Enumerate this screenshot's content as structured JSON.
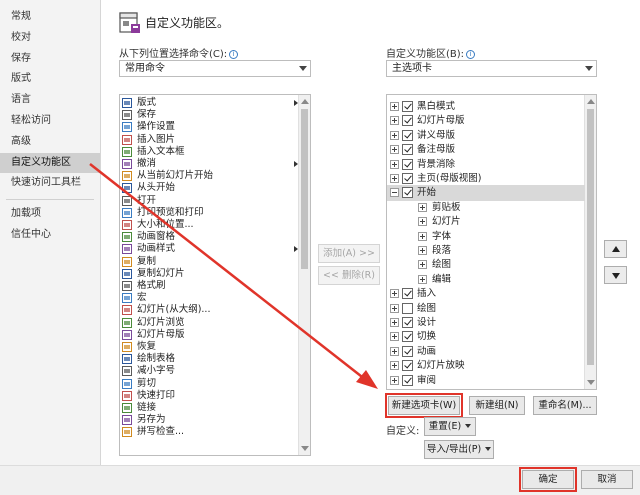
{
  "nav": {
    "items": [
      {
        "label": "常规",
        "sel": false
      },
      {
        "label": "校对",
        "sel": false
      },
      {
        "label": "保存",
        "sel": false
      },
      {
        "label": "版式",
        "sel": false
      },
      {
        "label": "语言",
        "sel": false
      },
      {
        "label": "轻松访问",
        "sel": false
      },
      {
        "label": "高级",
        "sel": false
      },
      {
        "label": "自定义功能区",
        "sel": true
      },
      {
        "label": "快速访问工具栏",
        "sel": false
      }
    ],
    "items2": [
      {
        "label": "加载项"
      },
      {
        "label": "信任中心"
      }
    ]
  },
  "header": {
    "title": "自定义功能区。"
  },
  "left": {
    "label": "从下列位置选择命令(C):",
    "combo_value": "常用命令",
    "commands": [
      {
        "label": "版式",
        "icon": "layout-icon",
        "sub": true
      },
      {
        "label": "保存",
        "icon": "save-icon"
      },
      {
        "label": "操作设置",
        "icon": "action-icon"
      },
      {
        "label": "插入图片",
        "icon": "picture-icon"
      },
      {
        "label": "插入文本框",
        "icon": "textbox-icon"
      },
      {
        "label": "撤消",
        "icon": "undo-icon",
        "sub": true
      },
      {
        "label": "从当前幻灯片开始",
        "icon": "slideshow-current-icon"
      },
      {
        "label": "从头开始",
        "icon": "slideshow-start-icon"
      },
      {
        "label": "打开",
        "icon": "open-folder-icon"
      },
      {
        "label": "打印预览和打印",
        "icon": "print-preview-icon"
      },
      {
        "label": "大小和位置...",
        "icon": "size-position-icon"
      },
      {
        "label": "动画窗格",
        "icon": "animation-pane-icon"
      },
      {
        "label": "动画样式",
        "icon": "animation-style-icon",
        "sub": true
      },
      {
        "label": "复制",
        "icon": "copy-icon"
      },
      {
        "label": "复制幻灯片",
        "icon": "duplicate-slide-icon"
      },
      {
        "label": "格式刷",
        "icon": "format-painter-icon"
      },
      {
        "label": "宏",
        "icon": "macro-icon"
      },
      {
        "label": "幻灯片(从大纲)...",
        "icon": "slides-from-outline-icon"
      },
      {
        "label": "幻灯片浏览",
        "icon": "slide-sorter-icon"
      },
      {
        "label": "幻灯片母版",
        "icon": "slide-master-icon"
      },
      {
        "label": "恢复",
        "icon": "redo-icon"
      },
      {
        "label": "绘制表格",
        "icon": "draw-table-icon"
      },
      {
        "label": "减小字号",
        "icon": "decrease-font-icon"
      },
      {
        "label": "剪切",
        "icon": "cut-icon"
      },
      {
        "label": "快速打印",
        "icon": "quick-print-icon"
      },
      {
        "label": "链接",
        "icon": "link-icon"
      },
      {
        "label": "另存为",
        "icon": "save-as-icon"
      },
      {
        "label": "拼写检查...",
        "icon": "spellcheck-icon"
      }
    ]
  },
  "middle": {
    "add_label": "添加(A) >>",
    "remove_label": "<< 删除(R)"
  },
  "right": {
    "label": "自定义功能区(B):",
    "combo_value": "主选项卡",
    "tree": [
      {
        "label": "黑白模式",
        "level": 0,
        "checked": true,
        "expanded": false
      },
      {
        "label": "幻灯片母版",
        "level": 0,
        "checked": true,
        "expanded": false
      },
      {
        "label": "讲义母版",
        "level": 0,
        "checked": true,
        "expanded": false
      },
      {
        "label": "备注母版",
        "level": 0,
        "checked": true,
        "expanded": false
      },
      {
        "label": "背景消除",
        "level": 0,
        "checked": true,
        "expanded": false
      },
      {
        "label": "主页(母版视图)",
        "level": 0,
        "checked": true,
        "expanded": false
      },
      {
        "label": "开始",
        "level": 0,
        "checked": true,
        "expanded": true,
        "sel": true
      },
      {
        "label": "剪贴板",
        "level": 1
      },
      {
        "label": "幻灯片",
        "level": 1
      },
      {
        "label": "字体",
        "level": 1
      },
      {
        "label": "段落",
        "level": 1
      },
      {
        "label": "绘图",
        "level": 1
      },
      {
        "label": "编辑",
        "level": 1
      },
      {
        "label": "插入",
        "level": 0,
        "checked": true,
        "expanded": false
      },
      {
        "label": "绘图",
        "level": 0,
        "checked": false,
        "expanded": false
      },
      {
        "label": "设计",
        "level": 0,
        "checked": true,
        "expanded": false
      },
      {
        "label": "切换",
        "level": 0,
        "checked": true,
        "expanded": false
      },
      {
        "label": "动画",
        "level": 0,
        "checked": true,
        "expanded": false
      },
      {
        "label": "幻灯片放映",
        "level": 0,
        "checked": true,
        "expanded": false
      },
      {
        "label": "审阅",
        "level": 0,
        "checked": true,
        "expanded": false
      }
    ],
    "new_tab_label": "新建选项卡(W)",
    "new_group_label": "新建组(N)",
    "rename_label": "重命名(M)...",
    "customize_label": "自定义:",
    "reset_label": "重置(E)",
    "import_export_label": "导入/导出(P)"
  },
  "footer": {
    "ok_label": "确定",
    "cancel_label": "取消"
  },
  "colors": {
    "highlight": "#e0342a",
    "accent": "#3a7cc2"
  }
}
